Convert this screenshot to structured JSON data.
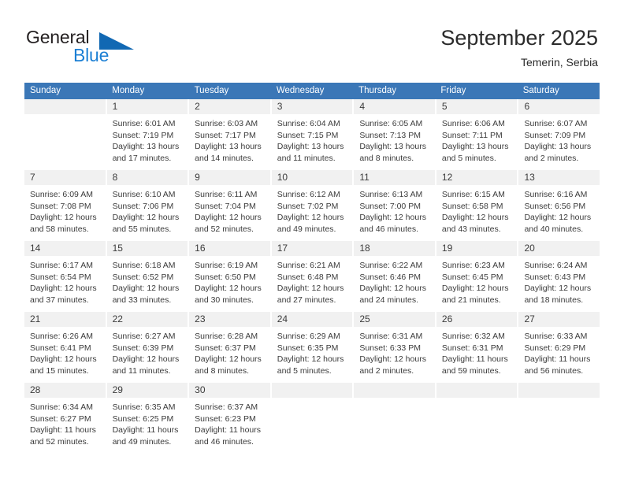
{
  "brand": {
    "name_part1": "General",
    "name_part2": "Blue",
    "triangle_icon": "blue-triangle-icon",
    "color_dark": "#231f20",
    "color_blue": "#1b7fd4"
  },
  "header": {
    "title": "September 2025",
    "subtitle": "Temerin, Serbia",
    "accent_color": "#3b77b7"
  },
  "weekdays": [
    "Sunday",
    "Monday",
    "Tuesday",
    "Wednesday",
    "Thursday",
    "Friday",
    "Saturday"
  ],
  "weeks": [
    [
      {
        "day": "",
        "lines": [
          "",
          "",
          "",
          ""
        ],
        "empty": true
      },
      {
        "day": "1",
        "lines": [
          "Sunrise: 6:01 AM",
          "Sunset: 7:19 PM",
          "Daylight: 13 hours",
          "and 17 minutes."
        ]
      },
      {
        "day": "2",
        "lines": [
          "Sunrise: 6:03 AM",
          "Sunset: 7:17 PM",
          "Daylight: 13 hours",
          "and 14 minutes."
        ]
      },
      {
        "day": "3",
        "lines": [
          "Sunrise: 6:04 AM",
          "Sunset: 7:15 PM",
          "Daylight: 13 hours",
          "and 11 minutes."
        ]
      },
      {
        "day": "4",
        "lines": [
          "Sunrise: 6:05 AM",
          "Sunset: 7:13 PM",
          "Daylight: 13 hours",
          "and 8 minutes."
        ]
      },
      {
        "day": "5",
        "lines": [
          "Sunrise: 6:06 AM",
          "Sunset: 7:11 PM",
          "Daylight: 13 hours",
          "and 5 minutes."
        ]
      },
      {
        "day": "6",
        "lines": [
          "Sunrise: 6:07 AM",
          "Sunset: 7:09 PM",
          "Daylight: 13 hours",
          "and 2 minutes."
        ]
      }
    ],
    [
      {
        "day": "7",
        "lines": [
          "Sunrise: 6:09 AM",
          "Sunset: 7:08 PM",
          "Daylight: 12 hours",
          "and 58 minutes."
        ]
      },
      {
        "day": "8",
        "lines": [
          "Sunrise: 6:10 AM",
          "Sunset: 7:06 PM",
          "Daylight: 12 hours",
          "and 55 minutes."
        ]
      },
      {
        "day": "9",
        "lines": [
          "Sunrise: 6:11 AM",
          "Sunset: 7:04 PM",
          "Daylight: 12 hours",
          "and 52 minutes."
        ]
      },
      {
        "day": "10",
        "lines": [
          "Sunrise: 6:12 AM",
          "Sunset: 7:02 PM",
          "Daylight: 12 hours",
          "and 49 minutes."
        ]
      },
      {
        "day": "11",
        "lines": [
          "Sunrise: 6:13 AM",
          "Sunset: 7:00 PM",
          "Daylight: 12 hours",
          "and 46 minutes."
        ]
      },
      {
        "day": "12",
        "lines": [
          "Sunrise: 6:15 AM",
          "Sunset: 6:58 PM",
          "Daylight: 12 hours",
          "and 43 minutes."
        ]
      },
      {
        "day": "13",
        "lines": [
          "Sunrise: 6:16 AM",
          "Sunset: 6:56 PM",
          "Daylight: 12 hours",
          "and 40 minutes."
        ]
      }
    ],
    [
      {
        "day": "14",
        "lines": [
          "Sunrise: 6:17 AM",
          "Sunset: 6:54 PM",
          "Daylight: 12 hours",
          "and 37 minutes."
        ]
      },
      {
        "day": "15",
        "lines": [
          "Sunrise: 6:18 AM",
          "Sunset: 6:52 PM",
          "Daylight: 12 hours",
          "and 33 minutes."
        ]
      },
      {
        "day": "16",
        "lines": [
          "Sunrise: 6:19 AM",
          "Sunset: 6:50 PM",
          "Daylight: 12 hours",
          "and 30 minutes."
        ]
      },
      {
        "day": "17",
        "lines": [
          "Sunrise: 6:21 AM",
          "Sunset: 6:48 PM",
          "Daylight: 12 hours",
          "and 27 minutes."
        ]
      },
      {
        "day": "18",
        "lines": [
          "Sunrise: 6:22 AM",
          "Sunset: 6:46 PM",
          "Daylight: 12 hours",
          "and 24 minutes."
        ]
      },
      {
        "day": "19",
        "lines": [
          "Sunrise: 6:23 AM",
          "Sunset: 6:45 PM",
          "Daylight: 12 hours",
          "and 21 minutes."
        ]
      },
      {
        "day": "20",
        "lines": [
          "Sunrise: 6:24 AM",
          "Sunset: 6:43 PM",
          "Daylight: 12 hours",
          "and 18 minutes."
        ]
      }
    ],
    [
      {
        "day": "21",
        "lines": [
          "Sunrise: 6:26 AM",
          "Sunset: 6:41 PM",
          "Daylight: 12 hours",
          "and 15 minutes."
        ]
      },
      {
        "day": "22",
        "lines": [
          "Sunrise: 6:27 AM",
          "Sunset: 6:39 PM",
          "Daylight: 12 hours",
          "and 11 minutes."
        ]
      },
      {
        "day": "23",
        "lines": [
          "Sunrise: 6:28 AM",
          "Sunset: 6:37 PM",
          "Daylight: 12 hours",
          "and 8 minutes."
        ]
      },
      {
        "day": "24",
        "lines": [
          "Sunrise: 6:29 AM",
          "Sunset: 6:35 PM",
          "Daylight: 12 hours",
          "and 5 minutes."
        ]
      },
      {
        "day": "25",
        "lines": [
          "Sunrise: 6:31 AM",
          "Sunset: 6:33 PM",
          "Daylight: 12 hours",
          "and 2 minutes."
        ]
      },
      {
        "day": "26",
        "lines": [
          "Sunrise: 6:32 AM",
          "Sunset: 6:31 PM",
          "Daylight: 11 hours",
          "and 59 minutes."
        ]
      },
      {
        "day": "27",
        "lines": [
          "Sunrise: 6:33 AM",
          "Sunset: 6:29 PM",
          "Daylight: 11 hours",
          "and 56 minutes."
        ]
      }
    ],
    [
      {
        "day": "28",
        "lines": [
          "Sunrise: 6:34 AM",
          "Sunset: 6:27 PM",
          "Daylight: 11 hours",
          "and 52 minutes."
        ]
      },
      {
        "day": "29",
        "lines": [
          "Sunrise: 6:35 AM",
          "Sunset: 6:25 PM",
          "Daylight: 11 hours",
          "and 49 minutes."
        ]
      },
      {
        "day": "30",
        "lines": [
          "Sunrise: 6:37 AM",
          "Sunset: 6:23 PM",
          "Daylight: 11 hours",
          "and 46 minutes."
        ]
      },
      {
        "day": "",
        "lines": [
          "",
          "",
          "",
          ""
        ],
        "empty": true
      },
      {
        "day": "",
        "lines": [
          "",
          "",
          "",
          ""
        ],
        "empty": true
      },
      {
        "day": "",
        "lines": [
          "",
          "",
          "",
          ""
        ],
        "empty": true
      },
      {
        "day": "",
        "lines": [
          "",
          "",
          "",
          ""
        ],
        "empty": true
      }
    ]
  ]
}
